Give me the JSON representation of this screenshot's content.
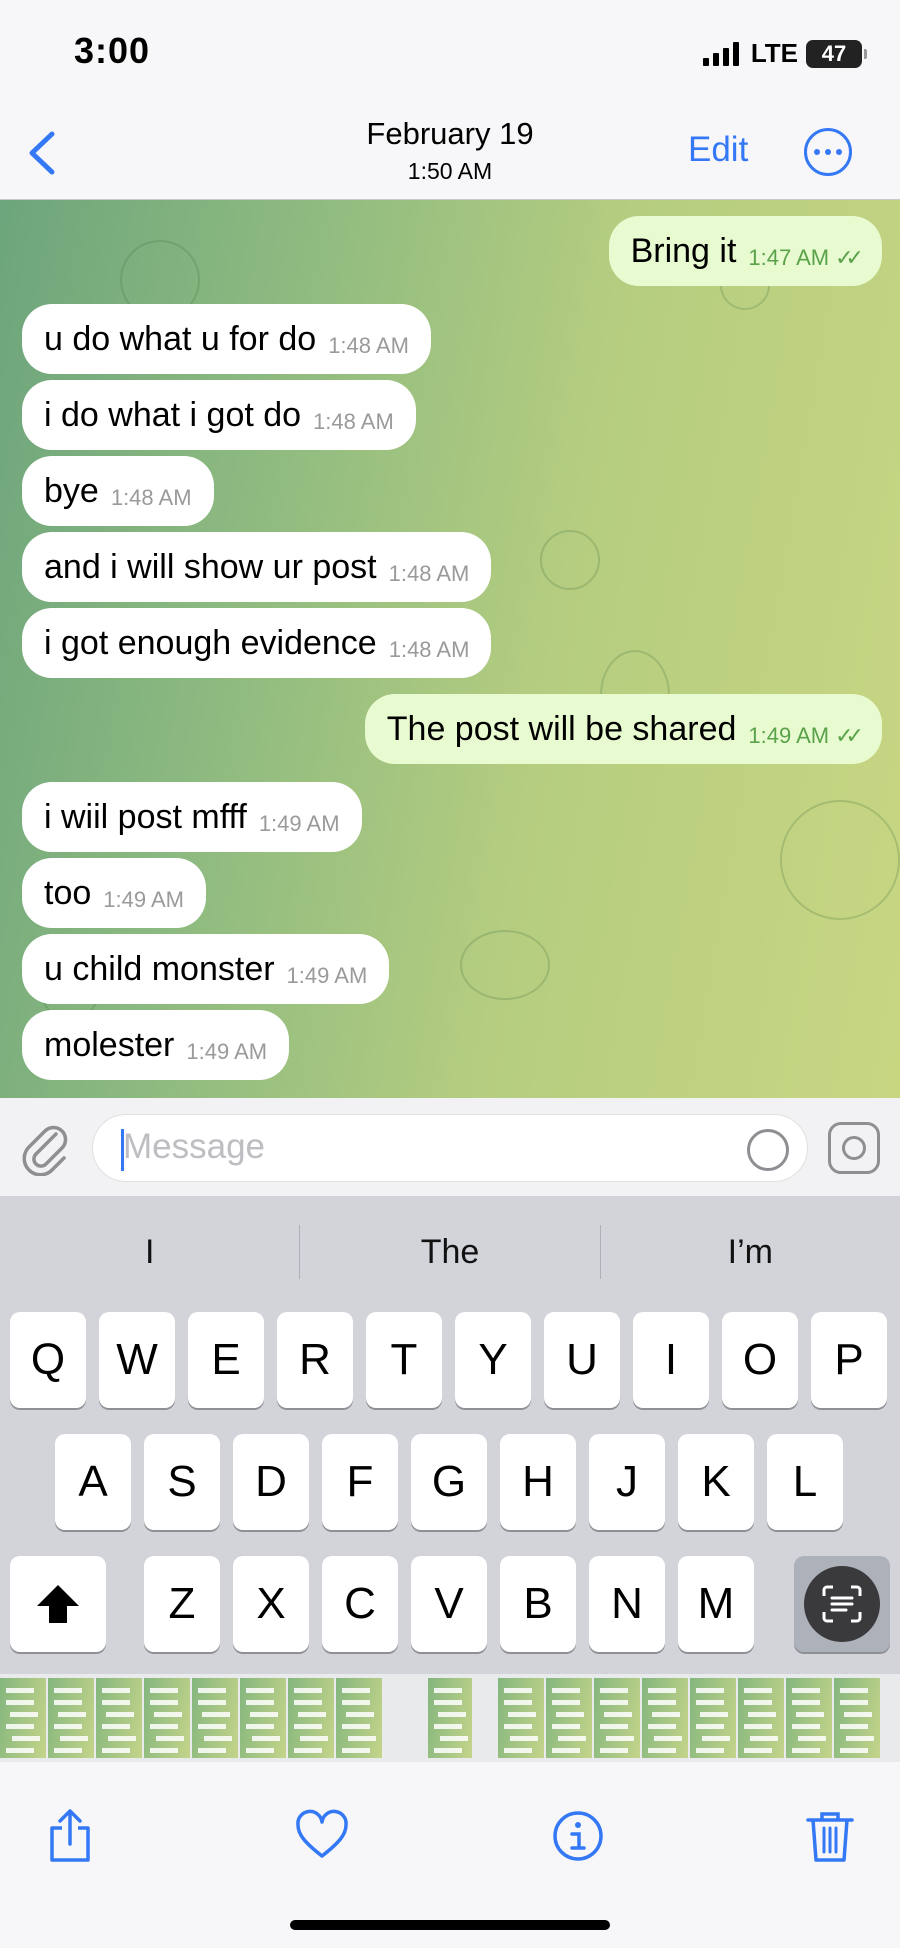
{
  "status_bar": {
    "time": "3:00",
    "network": "LTE",
    "battery": "47"
  },
  "header": {
    "title": "February 19",
    "subtitle": "1:50 AM",
    "edit_label": "Edit"
  },
  "messages": [
    {
      "direction": "out",
      "text": "Bring it",
      "time": "1:47 AM",
      "read": true
    },
    {
      "direction": "in",
      "text": "u do what u for do",
      "time": "1:48 AM"
    },
    {
      "direction": "in",
      "text": "i do what i got do",
      "time": "1:48 AM"
    },
    {
      "direction": "in",
      "text": "bye",
      "time": "1:48 AM"
    },
    {
      "direction": "in",
      "text": "and i will show ur post",
      "time": "1:48 AM"
    },
    {
      "direction": "in",
      "text": "i got enough evidence",
      "time": "1:48 AM"
    },
    {
      "direction": "out",
      "text": "The post will be shared",
      "time": "1:49 AM",
      "read": true
    },
    {
      "direction": "in",
      "text": "i wiil post mfff",
      "time": "1:49 AM"
    },
    {
      "direction": "in",
      "text": "too",
      "time": "1:49 AM"
    },
    {
      "direction": "in",
      "text": "u child monster",
      "time": "1:49 AM"
    },
    {
      "direction": "in",
      "text": "molester",
      "time": "1:49 AM"
    }
  ],
  "input": {
    "placeholder": "Message"
  },
  "keyboard": {
    "suggestions": [
      "I",
      "The",
      "I’m"
    ],
    "rows": [
      [
        "Q",
        "W",
        "E",
        "R",
        "T",
        "Y",
        "U",
        "I",
        "O",
        "P"
      ],
      [
        "A",
        "S",
        "D",
        "F",
        "G",
        "H",
        "J",
        "K",
        "L"
      ],
      [
        "Z",
        "X",
        "C",
        "V",
        "B",
        "N",
        "M"
      ]
    ]
  },
  "icons": {
    "back": "chevron-left-icon",
    "more": "ellipsis-circle-icon",
    "attach": "paperclip-icon",
    "sticker": "sticker-icon",
    "camera": "camera-icon",
    "shift": "shift-icon",
    "scan": "text-scan-icon",
    "share": "share-icon",
    "favorite": "heart-icon",
    "info": "info-icon",
    "delete": "trash-icon"
  },
  "colors": {
    "accent": "#3478f6",
    "incoming_bubble": "#ffffff",
    "outgoing_bubble": "#e8fbd0",
    "read_check": "#59a24a"
  }
}
